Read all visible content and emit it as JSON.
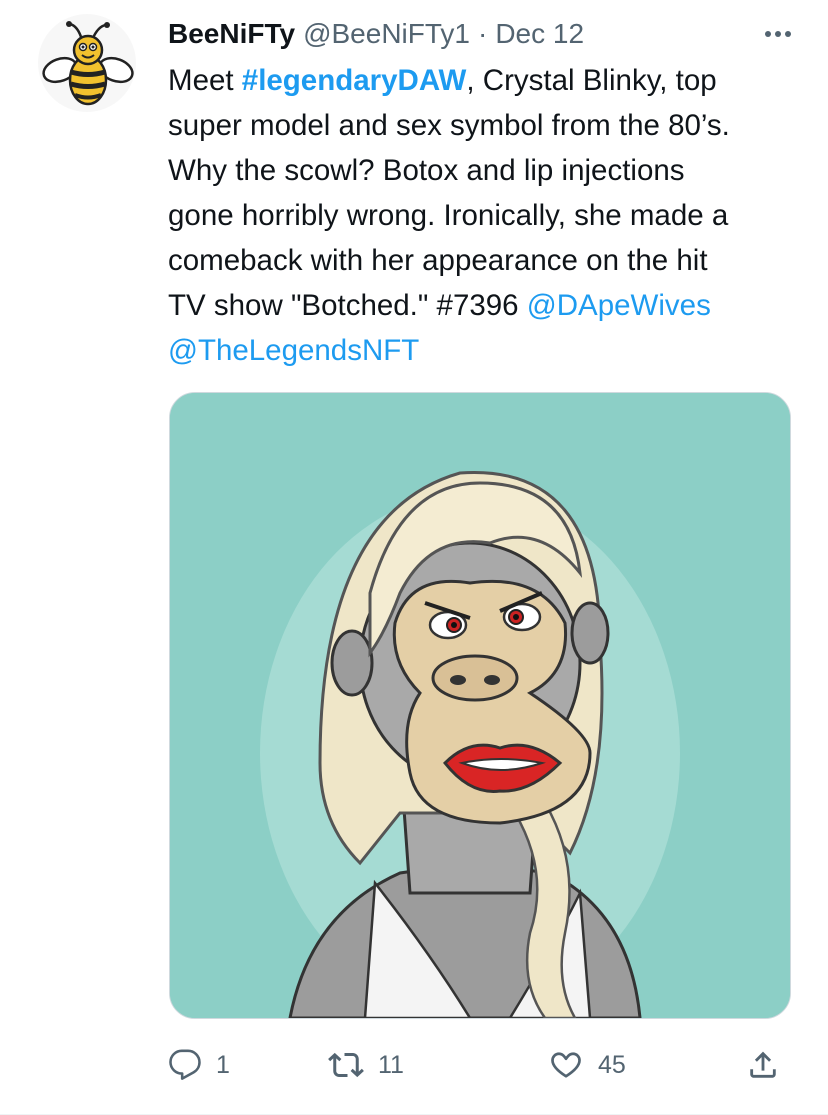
{
  "tweet": {
    "author": {
      "display_name": "BeeNiFTy",
      "handle": "@BeeNiFTy1",
      "separator": "·",
      "date": "Dec 12",
      "avatar_icon": "bee-icon"
    },
    "text": {
      "l1_a": "Meet ",
      "l1_hashtag": "#legendaryDAW",
      "l1_b": ", Crystal Blinky, top",
      "l2": "super model and sex symbol from the 80’s.",
      "l3": "Why the scowl? Botox and lip injections",
      "l4": "gone horribly wrong. Ironically, she made a",
      "l5": "comeback with her appearance on the hit",
      "l6_a": "TV show \"Botched.\" #7396 ",
      "l6_mention": "@DApeWives",
      "l7_mention": "@TheLegendsNFT"
    },
    "media": {
      "background_color": "#8ccfc6",
      "icon": "ape-portrait-image"
    },
    "actions": {
      "reply_count": "1",
      "retweet_count": "11",
      "like_count": "45"
    }
  },
  "colors": {
    "accent": "#1d9bf0",
    "secondary_text": "#536471",
    "primary_text": "#0f1419"
  }
}
